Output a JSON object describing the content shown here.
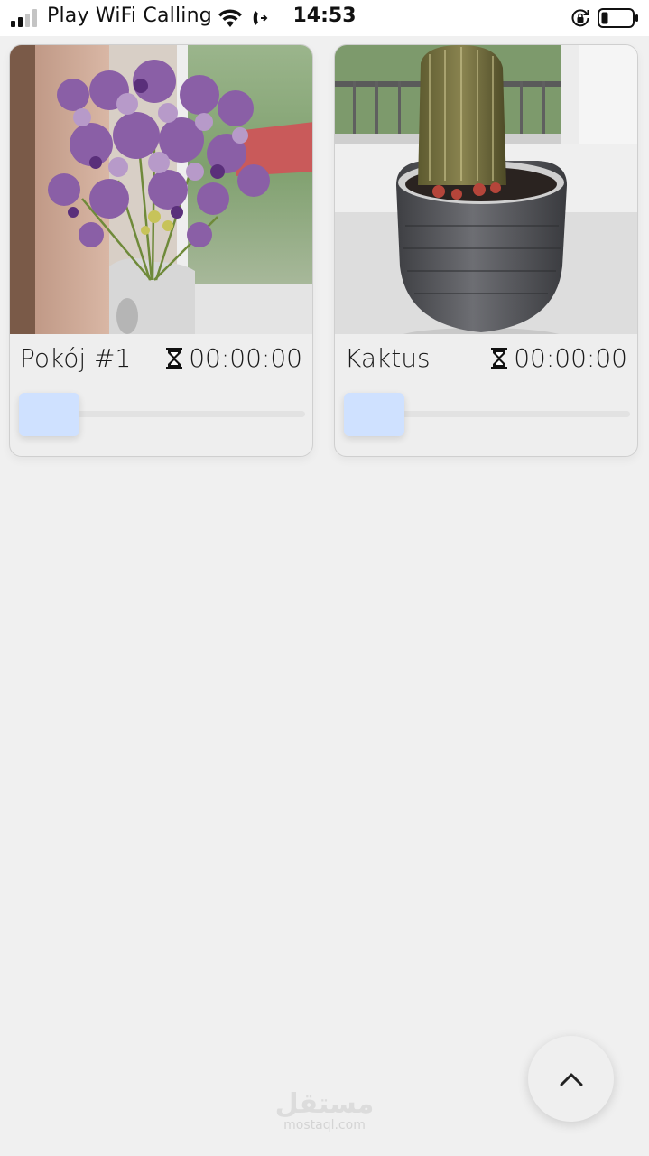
{
  "status_bar": {
    "carrier": "Play WiFi Calling",
    "time": "14:53",
    "icons": [
      "signal-icon",
      "wifi-icon",
      "wifi-calling-icon",
      "rotation-lock-icon",
      "battery-icon"
    ]
  },
  "plants": [
    {
      "name": "Pokój #1",
      "timer": "00:00:00",
      "photo_icon": "flower-bouquet-photo",
      "slider_value": 0
    },
    {
      "name": "Kaktus",
      "timer": "00:00:00",
      "photo_icon": "cactus-pot-photo",
      "slider_value": 0
    }
  ],
  "fab": {
    "icon": "chevron-up-icon"
  },
  "watermark": {
    "arabic": "مستقل",
    "latin": "mostaql.com"
  },
  "colors": {
    "background": "#f0f0f0",
    "slider_thumb": "#cfe1ff",
    "card_border": "#cfcfcf"
  }
}
